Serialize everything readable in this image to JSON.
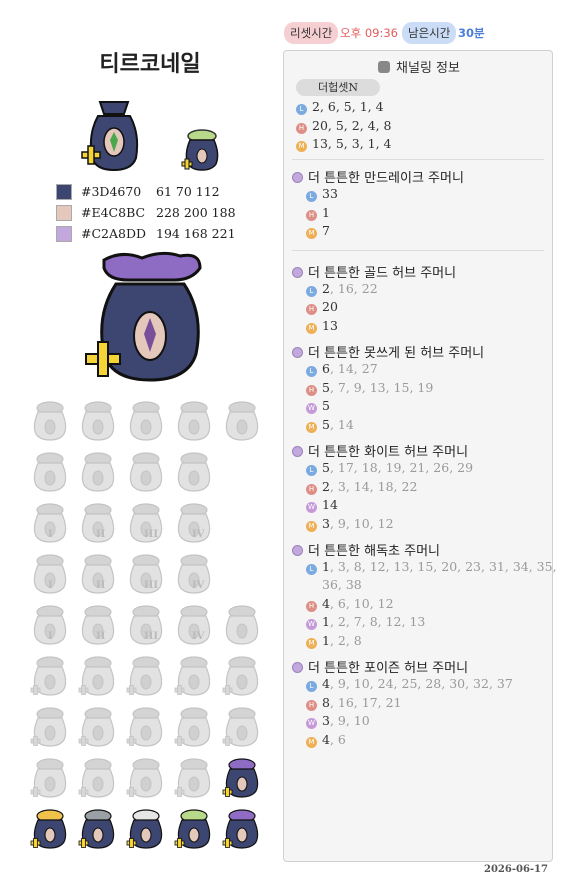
{
  "header": {
    "title": "티르코네일",
    "reset_label": "리셋시간",
    "reset_value": "오후 09:36",
    "remain_label": "남은시간",
    "remain_value": "30분"
  },
  "colors": [
    {
      "hex": "#3D4670",
      "rgb": "61 70 112"
    },
    {
      "hex": "#E4C8BC",
      "rgb": "228 200 188"
    },
    {
      "hex": "#C2A8DD",
      "rgb": "194 168 221"
    }
  ],
  "panel": {
    "title": "채널링 정보",
    "preset": "더헙셋N",
    "channels": [
      {
        "tag": "L",
        "text": "2, 6, 5, 1, 4"
      },
      {
        "tag": "H",
        "text": "20, 5, 2, 4, 8"
      },
      {
        "tag": "M",
        "text": "13, 5, 3, 1, 4"
      }
    ],
    "sections": [
      {
        "title": "더 튼튼한 만드레이크 주머니",
        "rows": [
          {
            "tag": "L",
            "main": "33",
            "rest": ""
          },
          {
            "tag": "H",
            "main": "1",
            "rest": ""
          },
          {
            "tag": "M",
            "main": "7",
            "rest": ""
          }
        ]
      },
      {
        "title": "더 튼튼한 골드 허브 주머니",
        "rows": [
          {
            "tag": "L",
            "main": "2",
            "rest": ", 16, 22"
          },
          {
            "tag": "H",
            "main": "20",
            "rest": ""
          },
          {
            "tag": "M",
            "main": "13",
            "rest": ""
          }
        ]
      },
      {
        "title": "더 튼튼한 못쓰게 된 허브 주머니",
        "rows": [
          {
            "tag": "L",
            "main": "6",
            "rest": ", 14, 27"
          },
          {
            "tag": "H",
            "main": "5",
            "rest": ", 7, 9, 13, 15, 19"
          },
          {
            "tag": "W",
            "main": "5",
            "rest": ""
          },
          {
            "tag": "M",
            "main": "5",
            "rest": ", 14"
          }
        ]
      },
      {
        "title": "더 튼튼한 화이트 허브 주머니",
        "rows": [
          {
            "tag": "L",
            "main": "5",
            "rest": ", 17, 18, 19, 21, 26, 29"
          },
          {
            "tag": "H",
            "main": "2",
            "rest": ", 3, 14, 18, 22"
          },
          {
            "tag": "W",
            "main": "14",
            "rest": ""
          },
          {
            "tag": "M",
            "main": "3",
            "rest": ", 9, 10, 12"
          }
        ]
      },
      {
        "title": "더 튼튼한 해독초 주머니",
        "rows": [
          {
            "tag": "L",
            "main": "1",
            "rest": ", 3, 8, 12, 13, 15, 20, 23, 31, 34, 35,",
            "rest2": "36, 38"
          },
          {
            "tag": "H",
            "main": "4",
            "rest": ", 6, 10, 12"
          },
          {
            "tag": "W",
            "main": "1",
            "rest": ", 2, 7, 8, 12, 13"
          },
          {
            "tag": "M",
            "main": "1",
            "rest": ", 2, 8"
          }
        ]
      },
      {
        "title": "더 튼튼한 포이즌 허브 주머니",
        "rows": [
          {
            "tag": "L",
            "main": "4",
            "rest": ", 9, 10, 24, 25, 28, 30, 32, 37"
          },
          {
            "tag": "H",
            "main": "8",
            "rest": ", 16, 17, 21"
          },
          {
            "tag": "W",
            "main": "3",
            "rest": ", 9, 10"
          },
          {
            "tag": "M",
            "main": "4",
            "rest": ", 6"
          }
        ]
      }
    ]
  },
  "grid_rows": [
    {
      "count": 5,
      "style": "gray"
    },
    {
      "count": 4,
      "style": "gray"
    },
    {
      "count": 4,
      "style": "gray",
      "numerals": [
        "I",
        "II",
        "III",
        "IV"
      ]
    },
    {
      "count": 4,
      "style": "gray",
      "numerals": [
        "I",
        "II",
        "III",
        "IV"
      ]
    },
    {
      "count": 5,
      "style": "gray",
      "numerals": [
        "I",
        "II",
        "III",
        "IV"
      ]
    },
    {
      "count": 5,
      "style": "gray"
    },
    {
      "count": 5,
      "style": "gray"
    },
    {
      "count": 5,
      "style": "mixed"
    },
    {
      "count": 5,
      "style": "color"
    }
  ],
  "footer": {
    "date": "2026-06-17"
  }
}
